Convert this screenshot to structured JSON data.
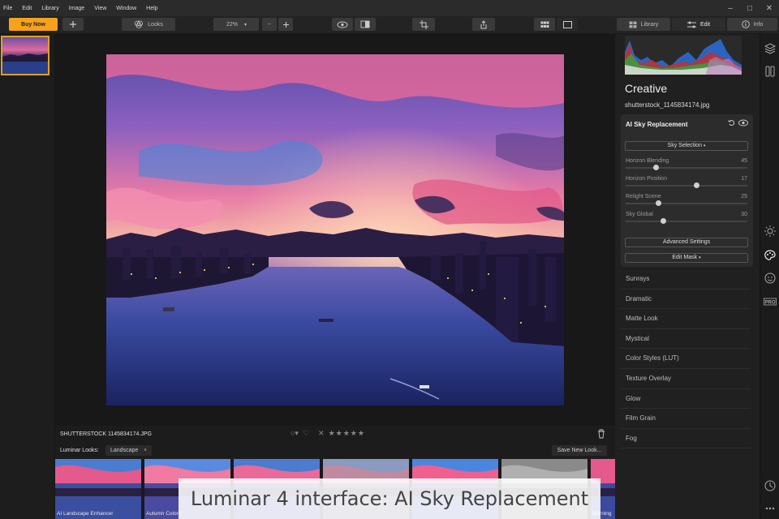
{
  "menu": [
    "File",
    "Edit",
    "Library",
    "Image",
    "View",
    "Window",
    "Help"
  ],
  "toolbar": {
    "buy_label": "Buy Now",
    "looks_label": "Looks",
    "zoom": "22%",
    "tabs": [
      {
        "label": "Library",
        "icon": "library-icon"
      },
      {
        "label": "Edit",
        "icon": "sliders-icon"
      },
      {
        "label": "Info",
        "icon": "info-icon"
      }
    ]
  },
  "image": {
    "filename": "SHUTTERSTOCK 1145834174.JPG",
    "rating_stars": 5,
    "rating_value": 0
  },
  "looks": {
    "label": "Luminar Looks:",
    "category": "Landscape",
    "save_label": "Save New Look...",
    "items": [
      {
        "name": "AI Landscape Enhancer"
      },
      {
        "name": "Autumn Colors"
      },
      {
        "name": ""
      },
      {
        "name": ""
      },
      {
        "name": ""
      },
      {
        "name": ""
      },
      {
        "name": "Morning"
      }
    ]
  },
  "caption": "Luminar 4 interface: AI Sky Replacement",
  "panel": {
    "title": "Creative",
    "filename": "shutterstock_1145834174.jpg",
    "sky": {
      "title": "AI Sky Replacement",
      "selection_label": "Sky Selection",
      "sliders": [
        {
          "label": "Horizon Blending",
          "value": 45,
          "fraction": 0.25
        },
        {
          "label": "Horizon Position",
          "value": 17,
          "fraction": 0.58
        },
        {
          "label": "Relight Scene",
          "value": 25,
          "fraction": 0.27
        },
        {
          "label": "Sky Global",
          "value": 30,
          "fraction": 0.31
        }
      ],
      "advanced_label": "Advanced Settings",
      "mask_label": "Edit Mask"
    },
    "filters": [
      "Sunrays",
      "Dramatic",
      "Matte Look",
      "Mystical",
      "Color Styles (LUT)",
      "Texture Overlay",
      "Glow",
      "Film Grain",
      "Fog"
    ]
  },
  "colors": {
    "accent": "#f6a21a",
    "panel": "#2c2c2c"
  }
}
